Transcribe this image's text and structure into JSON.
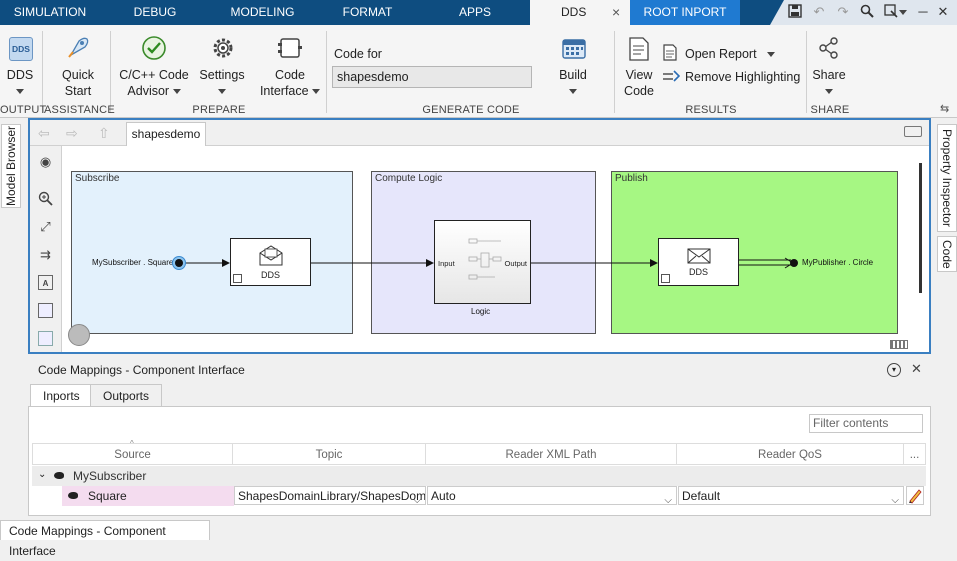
{
  "tabs": {
    "simulation": "SIMULATION",
    "debug": "DEBUG",
    "modeling": "MODELING",
    "format": "FORMAT",
    "apps": "APPS",
    "dds": "DDS",
    "close": "×",
    "root_inport": "ROOT INPORT"
  },
  "ribbon": {
    "dds_btn": "DDS",
    "dds_icon_text": "DDS",
    "quick_start_1": "Quick",
    "quick_start_2": "Start",
    "cpp_advisor_1": "C/C++ Code",
    "cpp_advisor_2": "Advisor",
    "settings": "Settings",
    "code_interface_1": "Code",
    "code_interface_2": "Interface",
    "code_for_label": "Code for",
    "code_for_value": "shapesdemo",
    "build": "Build",
    "view_code_1": "View",
    "view_code_2": "Code",
    "open_report": "Open Report",
    "remove_highlighting": "Remove Highlighting",
    "share": "Share",
    "groups": {
      "output": "OUTPUT",
      "assistance": "ASSISTANCE",
      "prepare": "PREPARE",
      "generate_code": "GENERATE CODE",
      "results": "RESULTS",
      "share": "SHARE"
    }
  },
  "side": {
    "model_browser": "Model Browser",
    "property_inspector": "Property Inspector",
    "code": "Code"
  },
  "editor": {
    "breadcrumb": "shapesdemo"
  },
  "diagram": {
    "subscribe_area": "Subscribe",
    "compute_area": "Compute Logic",
    "publish_area": "Publish",
    "sub_port": "MySubscriber . Square",
    "dds_block_in": "DDS",
    "logic_in": "Input",
    "logic_out": "Output",
    "logic_name": "Logic",
    "dds_block_out": "DDS",
    "pub_port": "MyPublisher . Circle",
    "colors": {
      "subscribe": "#e3f1fc",
      "compute": "#e6e6fb",
      "publish": "#a6f783"
    }
  },
  "code_mappings": {
    "title": "Code Mappings - Component Interface",
    "tab_inports": "Inports",
    "tab_outports": "Outports",
    "filter_placeholder": "Filter contents",
    "columns": [
      "Source",
      "Topic",
      "Reader XML Path",
      "Reader QoS",
      "..."
    ],
    "group": "MySubscriber",
    "row": {
      "source": "Square",
      "topic": "ShapesDomainLibrary/ShapesDoma",
      "reader_xml_path": "Auto",
      "reader_qos": "Default"
    }
  },
  "bottom_tab": "Code Mappings - Component Interface"
}
